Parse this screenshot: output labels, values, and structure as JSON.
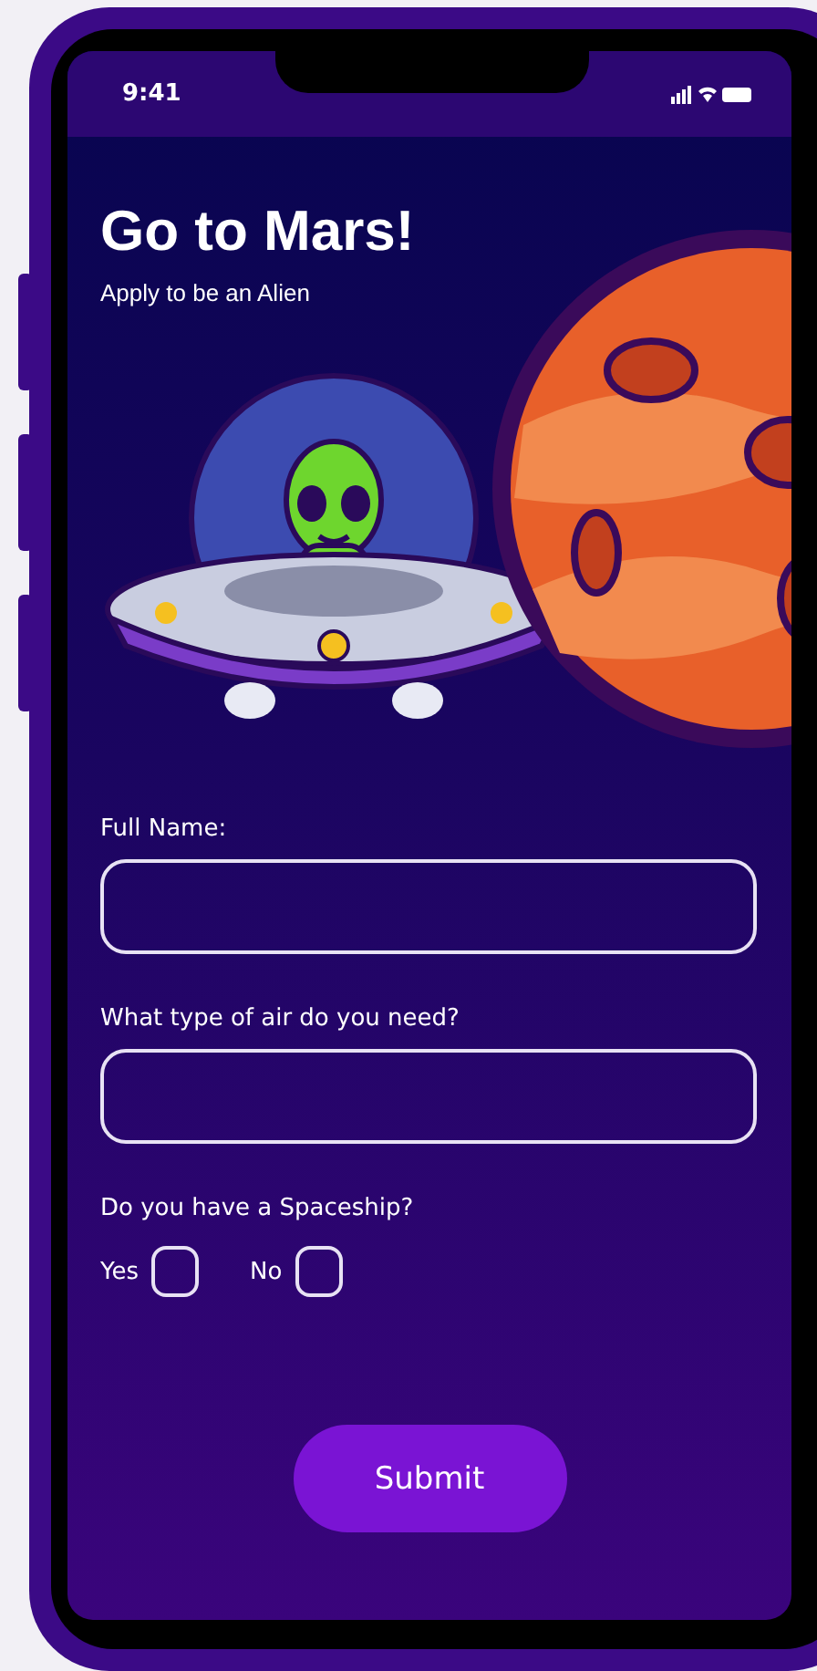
{
  "status_bar": {
    "time": "9:41"
  },
  "header": {
    "title": "Go to Mars!",
    "subtitle": "Apply to be an Alien"
  },
  "fields": [
    {
      "label": "Full Name:"
    },
    {
      "label": "What type of air do you need?"
    }
  ],
  "question": {
    "label": "Do you have a Spaceship?",
    "options": [
      {
        "label": "Yes",
        "checked": false
      },
      {
        "label": "No",
        "checked": false
      }
    ]
  },
  "submit": {
    "label": "Submit"
  }
}
